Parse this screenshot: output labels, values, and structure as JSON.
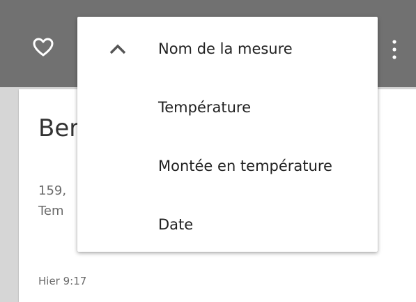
{
  "toolbar": {
    "favorite_icon": "heart-outline-icon",
    "overflow_icon": "more-vertical-icon"
  },
  "card": {
    "title": "Ber",
    "value_line": "159,",
    "type_line": "Tem",
    "date": "Hier 9:17"
  },
  "sort_menu": {
    "items": [
      {
        "label": "Nom de la mesure",
        "icon": "chevron-up-icon",
        "active": true
      },
      {
        "label": "Température",
        "active": false
      },
      {
        "label": "Montée en température",
        "active": false
      },
      {
        "label": "Date",
        "active": false
      }
    ]
  },
  "colors": {
    "toolbar": "#717171",
    "background": "#d6d6d6",
    "card": "#ffffff",
    "menu_text": "#212121",
    "secondary_text": "#6a6a6a"
  }
}
